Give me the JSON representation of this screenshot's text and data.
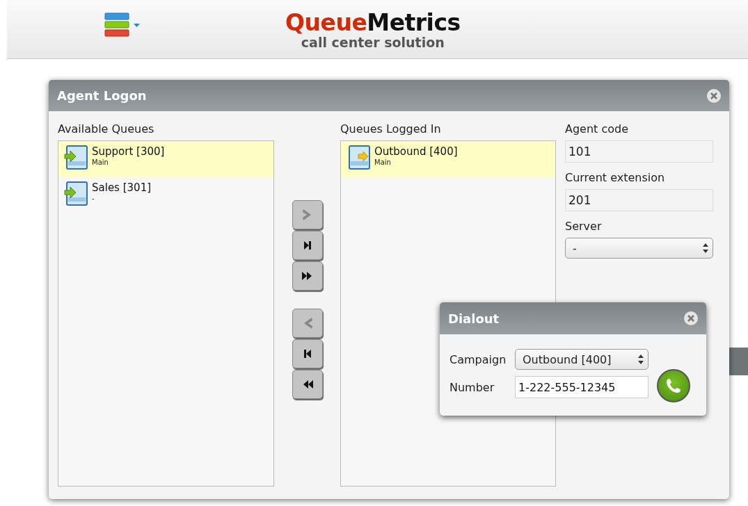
{
  "header": {
    "logo": {
      "part_1": "Queue",
      "part_2": "Metrics",
      "tagline": "call center solution"
    }
  },
  "agent_logon": {
    "title": "Agent Logon",
    "available_queues": {
      "label": "Available Queues",
      "items": [
        {
          "name": "Support [300]",
          "sub": "Main",
          "selected": true
        },
        {
          "name": "Sales [301]",
          "sub": "-",
          "selected": false
        }
      ]
    },
    "move_buttons": [
      {
        "kind": "one-right",
        "disabled": true
      },
      {
        "kind": "end-right",
        "disabled": false
      },
      {
        "kind": "all-right",
        "disabled": false
      },
      {
        "kind": "one-left",
        "disabled": true
      },
      {
        "kind": "end-left",
        "disabled": false
      },
      {
        "kind": "all-left",
        "disabled": false
      }
    ],
    "queues_logged_in": {
      "label": "Queues Logged In",
      "items": [
        {
          "name": "Outbound [400]",
          "sub": "Main",
          "selected": true
        }
      ]
    },
    "agent_code": {
      "label": "Agent code",
      "value": "101"
    },
    "current_extension": {
      "label": "Current extension",
      "value": "201"
    },
    "server": {
      "label": "Server",
      "value": "-"
    }
  },
  "dialout": {
    "title": "Dialout",
    "campaign": {
      "label": "Campaign",
      "value": "Outbound [400]"
    },
    "number": {
      "label": "Number",
      "value": "1-222-555-12345"
    }
  }
}
